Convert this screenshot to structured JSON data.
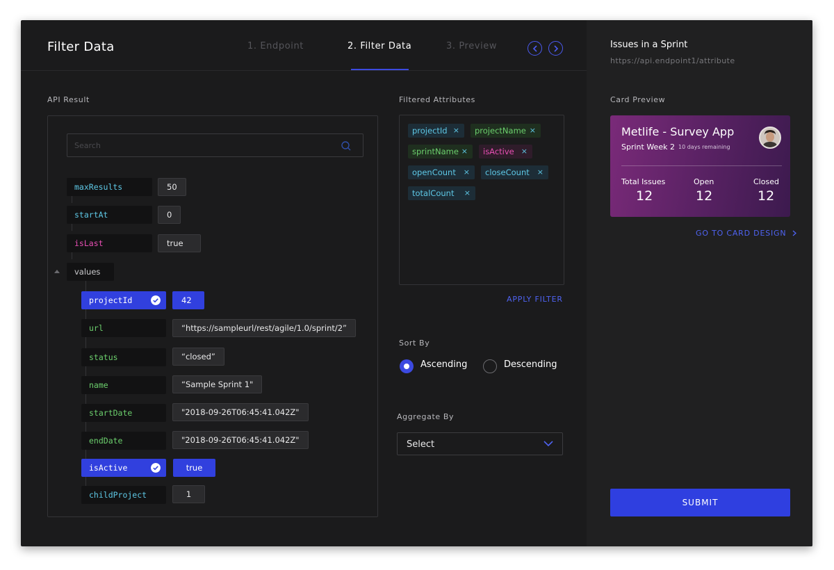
{
  "header": {
    "title": "Filter Data",
    "steps": [
      "1. Endpoint",
      "2. Filter Data",
      "3. Preview"
    ],
    "prev_icon": "chevron-left-icon",
    "next_icon": "chevron-right-icon"
  },
  "api_result": {
    "label": "API Result",
    "search_placeholder": "Search",
    "rows": [
      {
        "key": "maxResults",
        "value": "50"
      },
      {
        "key": "startAt",
        "value": "0"
      },
      {
        "key": "isLast",
        "value": "true"
      },
      {
        "key": "values"
      },
      {
        "key": "projectId",
        "value": "42",
        "selected": true
      },
      {
        "key": "url",
        "value": "“https://sampleurl/rest/agile/1.0/sprint/2”"
      },
      {
        "key": "status",
        "value": "“closed”"
      },
      {
        "key": "name",
        "value": "“Sample Sprint 1\""
      },
      {
        "key": "startDate",
        "value": "\"2018-09-26T06:45:41.042Z\""
      },
      {
        "key": "endDate",
        "value": "\"2018-09-26T06:45:41.042Z\""
      },
      {
        "key": "isActive",
        "value": "true",
        "selected": true
      },
      {
        "key": "childProject",
        "value": "1"
      }
    ]
  },
  "filtered": {
    "label": "Filtered Attributes",
    "chips": [
      "projectId",
      "projectName",
      "sprintName",
      "isActive",
      "openCount",
      "closeCount",
      "totalCount"
    ],
    "remove_symbol": "×",
    "apply_label": "APPLY FILTER"
  },
  "sort": {
    "label": "Sort By",
    "options": [
      "Ascending",
      "Descending"
    ],
    "selected": "Ascending"
  },
  "aggregate": {
    "label": "Aggregate By",
    "value": "Select"
  },
  "preview": {
    "title": "Issues in a Sprint",
    "endpoint": "https://api.endpoint1/attribute",
    "card_preview_label": "Card Preview",
    "card": {
      "title": "Metlife - Survey App",
      "subtitle": "Sprint Week 2",
      "remaining": "10 days remaining",
      "stats": [
        {
          "label": "Total Issues",
          "value": "12"
        },
        {
          "label": "Open",
          "value": "12"
        },
        {
          "label": "Closed",
          "value": "12"
        }
      ]
    },
    "card_link": "GO TO CARD DESIGN",
    "submit_label": "SUBMIT"
  },
  "colors": {
    "accent": "#3140de",
    "background": "#1b1b1c",
    "key_blue": "#5ec8e6",
    "key_green": "#6ccf6d",
    "key_pink": "#e84fb4"
  }
}
